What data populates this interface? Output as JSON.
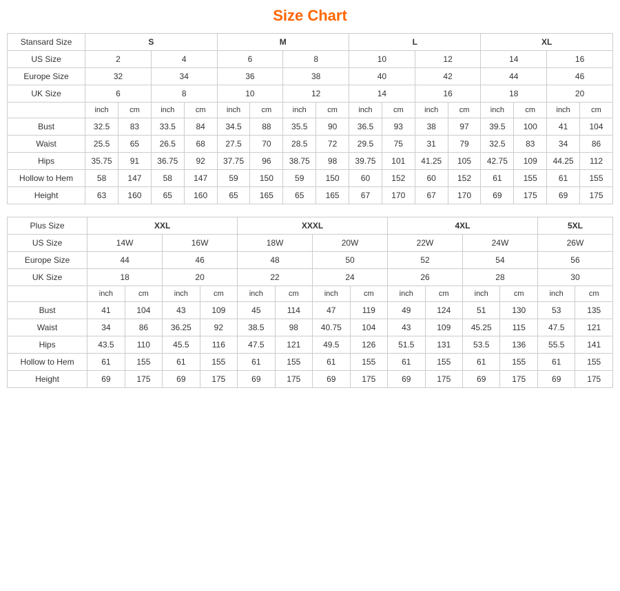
{
  "title": "Size Chart",
  "standard": {
    "label": "Stansard Size",
    "sizes": [
      "S",
      "M",
      "L",
      "XL"
    ],
    "us_label": "US Size",
    "us_sizes": [
      "2",
      "4",
      "6",
      "8",
      "10",
      "12",
      "14",
      "16"
    ],
    "eu_label": "Europe Size",
    "eu_sizes": [
      "32",
      "34",
      "36",
      "38",
      "40",
      "42",
      "44",
      "46"
    ],
    "uk_label": "UK Size",
    "uk_sizes": [
      "6",
      "8",
      "10",
      "12",
      "14",
      "16",
      "18",
      "20"
    ],
    "measurements": [
      {
        "label": "Bust",
        "values": [
          "32.5",
          "83",
          "33.5",
          "84",
          "34.5",
          "88",
          "35.5",
          "90",
          "36.5",
          "93",
          "38",
          "97",
          "39.5",
          "100",
          "41",
          "104"
        ]
      },
      {
        "label": "Waist",
        "values": [
          "25.5",
          "65",
          "26.5",
          "68",
          "27.5",
          "70",
          "28.5",
          "72",
          "29.5",
          "75",
          "31",
          "79",
          "32.5",
          "83",
          "34",
          "86"
        ]
      },
      {
        "label": "Hips",
        "values": [
          "35.75",
          "91",
          "36.75",
          "92",
          "37.75",
          "96",
          "38.75",
          "98",
          "39.75",
          "101",
          "41.25",
          "105",
          "42.75",
          "109",
          "44.25",
          "112"
        ]
      },
      {
        "label": "Hollow to Hem",
        "values": [
          "58",
          "147",
          "58",
          "147",
          "59",
          "150",
          "59",
          "150",
          "60",
          "152",
          "60",
          "152",
          "61",
          "155",
          "61",
          "155"
        ]
      },
      {
        "label": "Height",
        "values": [
          "63",
          "160",
          "65",
          "160",
          "65",
          "165",
          "65",
          "165",
          "67",
          "170",
          "67",
          "170",
          "69",
          "175",
          "69",
          "175"
        ]
      }
    ]
  },
  "plus": {
    "label": "Plus Size",
    "sizes": [
      "XXL",
      "XXXL",
      "4XL",
      "5XL"
    ],
    "us_label": "US Size",
    "us_sizes": [
      "14W",
      "16W",
      "18W",
      "20W",
      "22W",
      "24W",
      "26W"
    ],
    "eu_label": "Europe Size",
    "eu_sizes": [
      "44",
      "46",
      "48",
      "50",
      "52",
      "54",
      "56"
    ],
    "uk_label": "UK Size",
    "uk_sizes": [
      "18",
      "20",
      "22",
      "24",
      "26",
      "28",
      "30"
    ],
    "measurements": [
      {
        "label": "Bust",
        "values": [
          "41",
          "104",
          "43",
          "109",
          "45",
          "114",
          "47",
          "119",
          "49",
          "124",
          "51",
          "130",
          "53",
          "135"
        ]
      },
      {
        "label": "Waist",
        "values": [
          "34",
          "86",
          "36.25",
          "92",
          "38.5",
          "98",
          "40.75",
          "104",
          "43",
          "109",
          "45.25",
          "115",
          "47.5",
          "121"
        ]
      },
      {
        "label": "Hips",
        "values": [
          "43.5",
          "110",
          "45.5",
          "116",
          "47.5",
          "121",
          "49.5",
          "126",
          "51.5",
          "131",
          "53.5",
          "136",
          "55.5",
          "141"
        ]
      },
      {
        "label": "Hollow to Hem",
        "values": [
          "61",
          "155",
          "61",
          "155",
          "61",
          "155",
          "61",
          "155",
          "61",
          "155",
          "61",
          "155",
          "61",
          "155"
        ]
      },
      {
        "label": "Height",
        "values": [
          "69",
          "175",
          "69",
          "175",
          "69",
          "175",
          "69",
          "175",
          "69",
          "175",
          "69",
          "175",
          "69",
          "175"
        ]
      }
    ]
  }
}
